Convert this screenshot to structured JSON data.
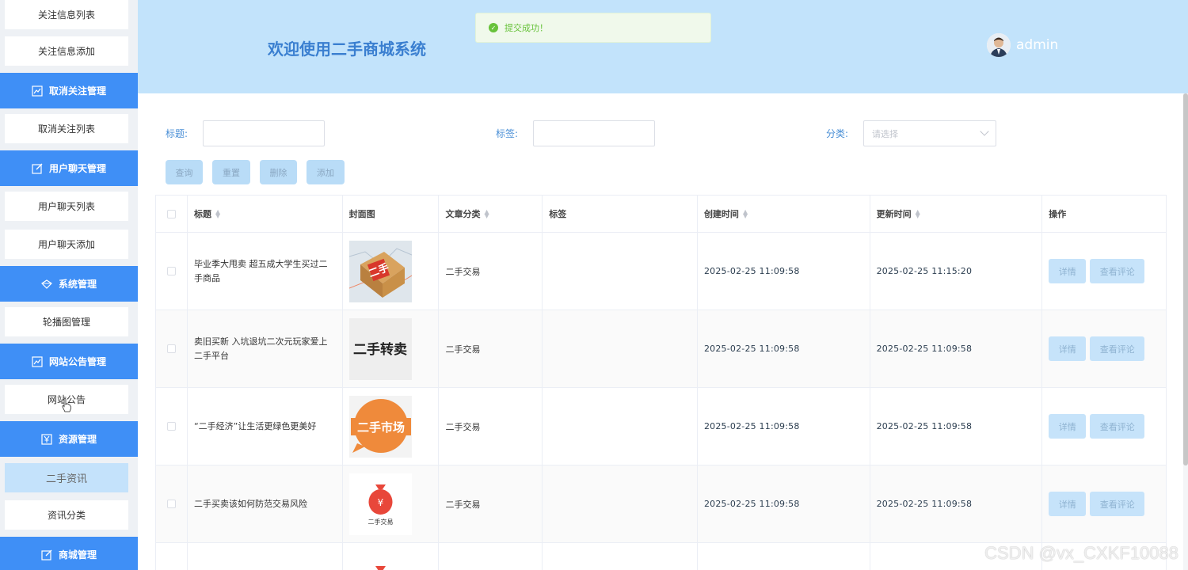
{
  "sidebar": {
    "items": [
      {
        "type": "item",
        "label": "关注信息列表"
      },
      {
        "type": "item",
        "label": "关注信息添加"
      },
      {
        "type": "group",
        "label": "取消关注管理",
        "icon": "chart-icon"
      },
      {
        "type": "item",
        "label": "取消关注列表"
      },
      {
        "type": "group",
        "label": "用户聊天管理",
        "icon": "edit-icon"
      },
      {
        "type": "item",
        "label": "用户聊天列表"
      },
      {
        "type": "item",
        "label": "用户聊天添加"
      },
      {
        "type": "group",
        "label": "系统管理",
        "icon": "diamond-icon"
      },
      {
        "type": "item",
        "label": "轮播图管理"
      },
      {
        "type": "group",
        "label": "网站公告管理",
        "icon": "chart-icon"
      },
      {
        "type": "item",
        "label": "网站公告"
      },
      {
        "type": "group",
        "label": "资源管理",
        "icon": "yen-icon"
      },
      {
        "type": "item",
        "label": "二手资讯",
        "active": true
      },
      {
        "type": "item",
        "label": "资讯分类"
      },
      {
        "type": "group",
        "label": "商城管理",
        "icon": "edit-icon"
      }
    ]
  },
  "header": {
    "title": "欢迎使用二手商城系统",
    "username": "admin"
  },
  "toast": {
    "message": "提交成功！"
  },
  "filters": {
    "title_label": "标题:",
    "tag_label": "标签:",
    "category_label": "分类:",
    "category_placeholder": "请选择"
  },
  "buttons": {
    "query": "查询",
    "reset": "重置",
    "delete": "删除",
    "add": "添加"
  },
  "table": {
    "headers": {
      "title": "标题",
      "cover": "封面图",
      "category": "文章分类",
      "tags": "标签",
      "created": "创建时间",
      "updated": "更新时间",
      "actions": "操作"
    },
    "detail_label": "详情",
    "comments_label": "查看评论",
    "rows": [
      {
        "title": "毕业季大甩卖 超五成大学生买过二手商品",
        "cover_text": "二手",
        "category": "二手交易",
        "tags": "",
        "created": "2025-02-25 11:09:58",
        "updated": "2025-02-25 11:15:20"
      },
      {
        "title": "卖旧买新 入坑退坑二次元玩家爱上二手平台",
        "cover_text": "二手转卖",
        "category": "二手交易",
        "tags": "",
        "created": "2025-02-25 11:09:58",
        "updated": "2025-02-25 11:09:58"
      },
      {
        "title": "“二手经济”让生活更绿色更美好",
        "cover_text": "二手市场",
        "category": "二手交易",
        "tags": "",
        "created": "2025-02-25 11:09:58",
        "updated": "2025-02-25 11:09:58"
      },
      {
        "title": "二手买卖该如何防范交易风险",
        "cover_text": "二手交易",
        "category": "二手交易",
        "tags": "",
        "created": "2025-02-25 11:09:58",
        "updated": "2025-02-25 11:09:58"
      }
    ]
  },
  "watermark": "CSDN @vx_CXKF10088",
  "colors": {
    "primary": "#3f8ff6",
    "header_bg": "#c2e3fb",
    "success": "#67c23a"
  }
}
